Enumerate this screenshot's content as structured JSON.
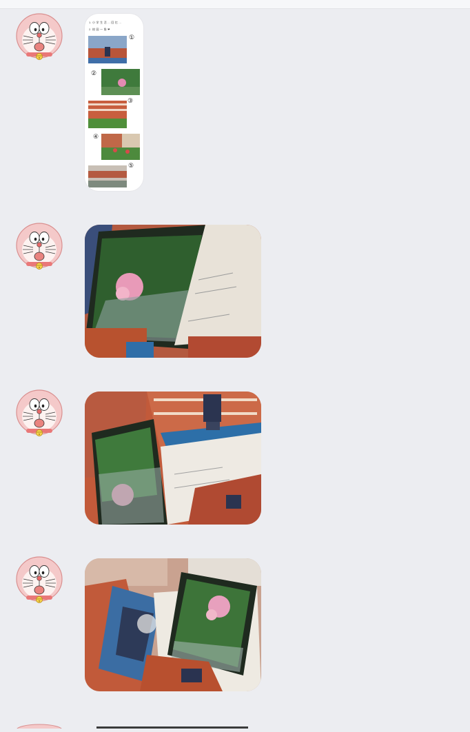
{
  "chat": {
    "background_color": "#ecedf1",
    "topbar_color": "#f6f7f9",
    "messages": [
      {
        "sender_avatar": "doraemon-avatar",
        "type": "long-image",
        "caption_line1": "1.  小 学 生 活 ... 回 忆 ...",
        "caption_line2": "2.  校 园 一 角  ❤"
      },
      {
        "sender_avatar": "doraemon-avatar",
        "type": "photo",
        "description_icon": "photo-collage-flower"
      },
      {
        "sender_avatar": "doraemon-avatar",
        "type": "photo",
        "description_icon": "photo-collage-building"
      },
      {
        "sender_avatar": "doraemon-avatar",
        "type": "photo",
        "description_icon": "photo-collage-mixed"
      }
    ],
    "doodles": [
      "①",
      "②",
      "③",
      "④",
      "⑤"
    ]
  }
}
